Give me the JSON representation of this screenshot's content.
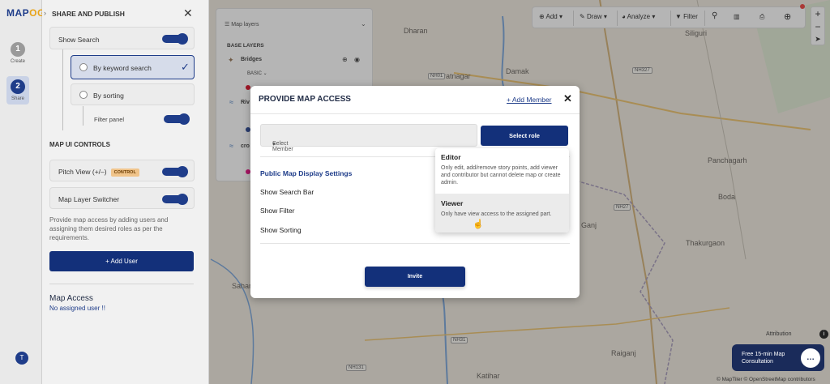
{
  "app": {
    "logo_main": "MAP",
    "logo_accent": "OG"
  },
  "rail": {
    "steps": [
      {
        "num": "1",
        "label": "Create"
      },
      {
        "num": "2",
        "label": "Share"
      }
    ],
    "bottom_icon": "T"
  },
  "panel": {
    "title": "SHARE AND PUBLISH",
    "show_search": "Show Search",
    "by_keyword": "By keyword search",
    "by_sorting": "By sorting",
    "filter_panel": "Filter panel",
    "map_ui_controls": "MAP UI CONTROLS",
    "pitch_view": "Pitch View (+/–)",
    "control_tag": "CONTROL",
    "layer_switcher": "Map Layer Switcher",
    "description": "Provide map access by adding users and assigning them desired roles as per the requirements.",
    "add_user": "+ Add User",
    "map_access": "Map Access",
    "no_user": "No assigned user !!"
  },
  "layers": {
    "header": "Map layers",
    "base_layers": "BASE LAYERS",
    "items": [
      "Bridges",
      "Riv",
      "cro"
    ],
    "basic": "BASIC"
  },
  "toolbar": {
    "add": "Add",
    "draw": "Draw",
    "analyze": "Analyze",
    "filter": "Filter"
  },
  "modal": {
    "title": "PROVIDE MAP ACCESS",
    "add_member": "+ Add Member",
    "select_member": "Select Member",
    "select_role": "Select role",
    "public_title": "Public Map Display Settings",
    "rows": [
      "Show Search Bar",
      "Show Filter",
      "Show Sorting"
    ],
    "invite": "Invite"
  },
  "dropdown": {
    "options": [
      {
        "title": "Editor",
        "desc": "Only edit, add/remove story points, add viewer and contributor but cannot delete map or create admin."
      },
      {
        "title": "Viewer",
        "desc": "Only have view access to the assigned part."
      }
    ]
  },
  "map_labels": {
    "places": [
      "Dharan",
      "Damak",
      "Biratnagar",
      "Siliguri",
      "Panchagarh",
      "Boda",
      "Thakurgaon",
      "Raiganj",
      "Katihar",
      "Sahar",
      "Ganj"
    ],
    "roads": [
      "NH01",
      "NH327",
      "NH27",
      "NH31",
      "NH131"
    ]
  },
  "consult": {
    "text": "Free 15-min Map Consultation"
  },
  "attribution": "Attribution",
  "copyright": "© MapTiler © OpenStreetMap contributors",
  "colors": {
    "primary": "#13307a",
    "accent": "#e8a317"
  }
}
